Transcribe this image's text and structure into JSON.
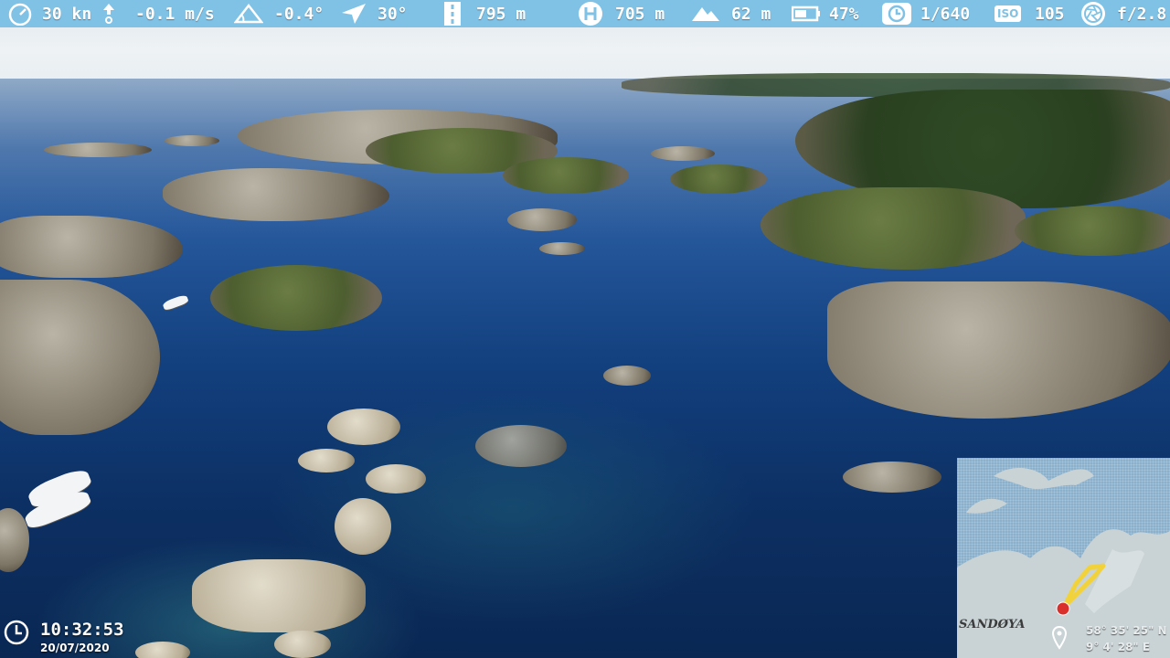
{
  "telemetry": {
    "speed": "30 kn",
    "vertical_speed": "-0.1 m/s",
    "gimbal_pitch": "-0.4°",
    "heading": "30°",
    "distance": "795 m",
    "home_distance": "705 m",
    "altitude": "62 m",
    "battery": "47%",
    "shutter": "1/640",
    "iso_label": "ISO",
    "iso": "105",
    "aperture": "f/2.8",
    "icons": [
      "speedometer-icon",
      "vertical-speed-icon",
      "gimbal-pitch-icon",
      "heading-arrow-icon",
      "distance-road-icon",
      "home-h-icon",
      "altitude-mountain-icon",
      "battery-icon",
      "shutter-clock-icon",
      "iso-icon",
      "aperture-icon"
    ]
  },
  "clock": {
    "time": "10:32:53",
    "date": "20/07/2020",
    "icon": "clock-icon"
  },
  "minimap": {
    "place_name": "SANDØYA",
    "latitude": "58° 35' 25\" N",
    "longitude": "9° 4' 28\" E",
    "icons": [
      "flight-path",
      "drone-position-marker",
      "location-pin-icon"
    ]
  },
  "colors": {
    "topbar": "#7fc2e6",
    "flight_path": "#f2d23a",
    "drone_marker": "#d9302c"
  }
}
